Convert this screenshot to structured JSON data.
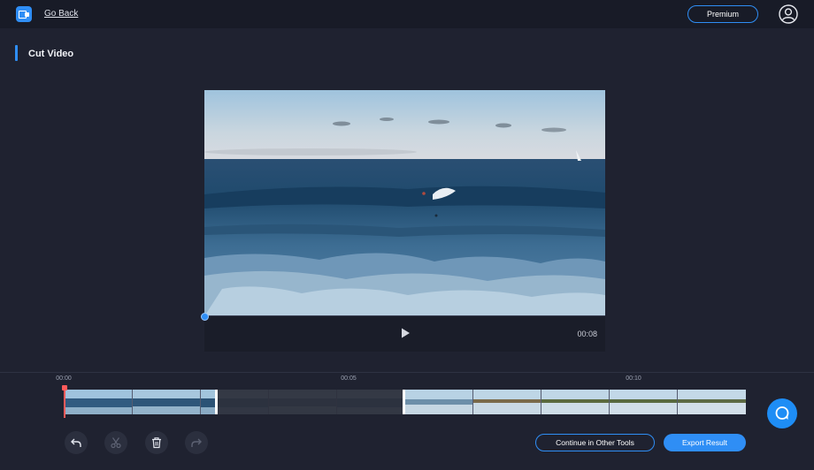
{
  "header": {
    "go_back_label": "Go Back",
    "premium_label": "Premium"
  },
  "page": {
    "title": "Cut Video"
  },
  "player": {
    "duration": "00:08"
  },
  "timeline": {
    "ticks": [
      "00:00",
      "00:05",
      "00:10"
    ]
  },
  "actions": {
    "continue_label": "Continue in Other Tools",
    "export_label": "Export Result"
  },
  "colors": {
    "accent": "#2f8ef5",
    "playhead": "#ff5a5a",
    "background": "#1f2230"
  }
}
